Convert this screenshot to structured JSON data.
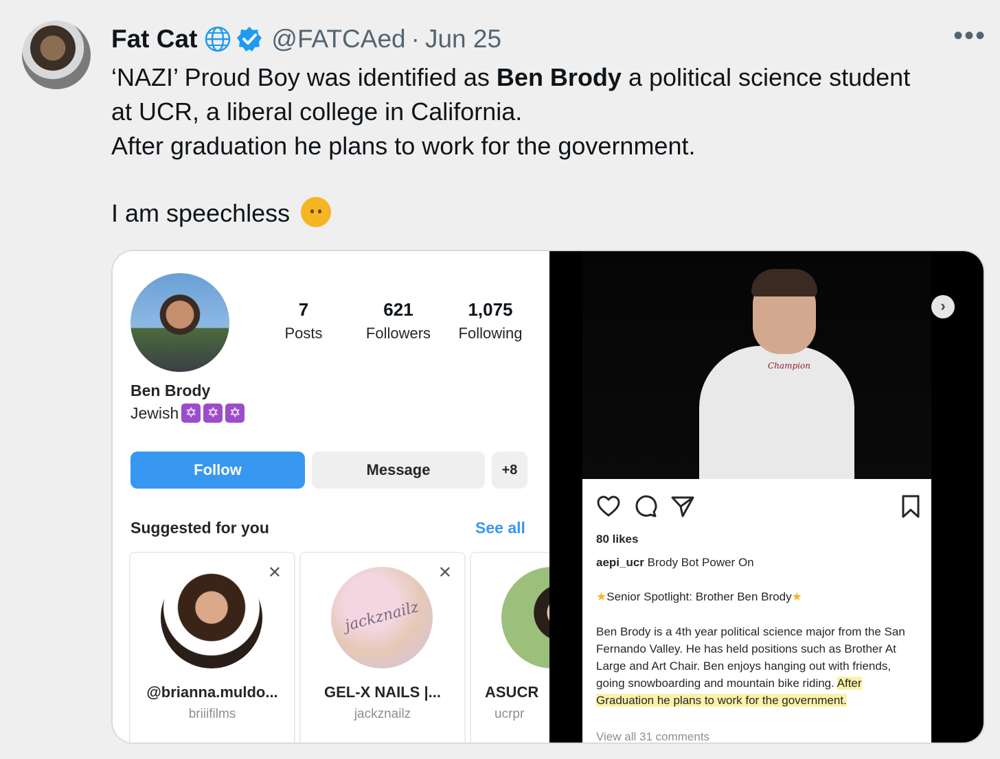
{
  "tweet": {
    "author_name": "Fat Cat",
    "handle": "@FATCAed",
    "separator": "·",
    "date": "Jun 25",
    "more": "•••",
    "text_line1_pre": "‘NAZI’ Proud Boy was identified as ",
    "text_line1_bold": "Ben Brody",
    "text_line1_post": " a political science student",
    "text_line2": "at UCR, a liberal college in California.",
    "text_line3": "After graduation he plans to work for the government.",
    "text_line4": "I am speechless"
  },
  "instagram_profile": {
    "stats": [
      {
        "num": "7",
        "label": "Posts"
      },
      {
        "num": "621",
        "label": "Followers"
      },
      {
        "num": "1,075",
        "label": "Following"
      }
    ],
    "name": "Ben Brody",
    "bio": "Jewish",
    "bio_emoji": "✡",
    "follow_label": "Follow",
    "message_label": "Message",
    "add_person_label": "+8",
    "suggested_title": "Suggested for you",
    "see_all_label": "See all",
    "dismiss": "✕",
    "suggestions": [
      {
        "username": "@brianna.muldo...",
        "subtitle": "briiifilms"
      },
      {
        "username": "GEL-X NAILS |...",
        "subtitle": "jackznailz",
        "logo_text": "jackznailz"
      },
      {
        "username": "ASUCR",
        "subtitle": "ucrpr"
      }
    ]
  },
  "instagram_post": {
    "shirt_logo": "Champion",
    "next_arrow": "›",
    "likes": "80 likes",
    "caption_user": "aepi_ucr",
    "caption_text": " Brody Bot Power On",
    "spotlight_star": "★",
    "spotlight": "Senior Spotlight: Brother Ben Brody",
    "body_pre": "Ben Brody is a 4th year political science major from the San Fernando Valley. He has held positions such as Brother At Large and Art Chair. Ben enjoys hanging out with friends, going snowboarding and mountain bike riding. ",
    "body_highlight": "After Graduation he plans to work for the government.",
    "view_comments": "View all 31 comments"
  },
  "colors": {
    "verified": "#1d9bf0",
    "ig_blue": "#3897f0",
    "highlight": "#fbf1a9",
    "emoji": "#f5b624"
  }
}
